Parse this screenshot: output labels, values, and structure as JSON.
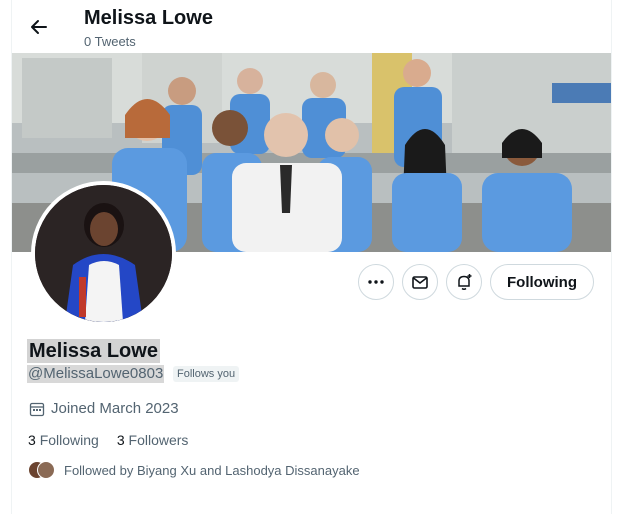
{
  "header": {
    "title": "Melissa Lowe",
    "subtitle": "0 Tweets"
  },
  "actions": {
    "following_label": "Following"
  },
  "profile": {
    "name": "Melissa Lowe",
    "handle": "@MelissaLowe0803",
    "follows_you": "Follows you",
    "joined": "Joined March 2023",
    "following_count": "3",
    "following_label": "Following",
    "followers_count": "3",
    "followers_label": "Followers",
    "followed_by": "Followed by Biyang Xu and Lashodya Dissanayake"
  },
  "colors": {
    "accent": "#1d9bf0",
    "text_secondary": "#536471",
    "lab_coat_blue": "#4f8fd6"
  }
}
